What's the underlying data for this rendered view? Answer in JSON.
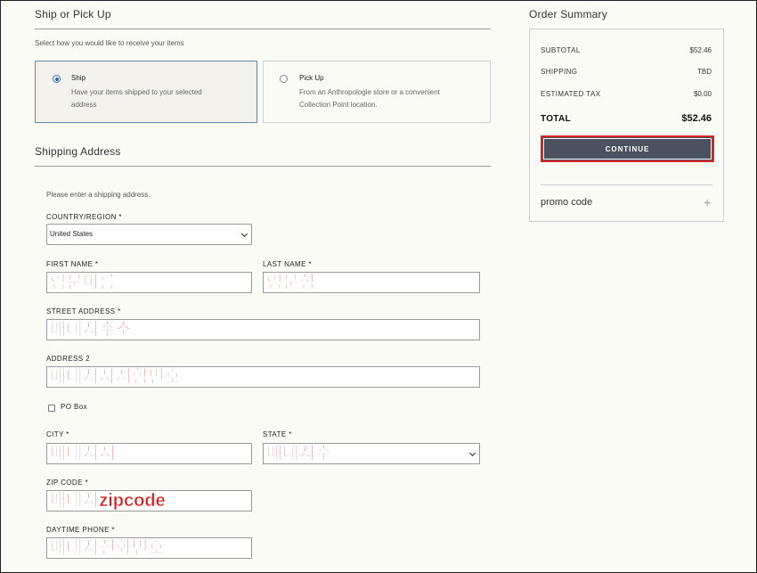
{
  "ship_section": {
    "title": "Ship or Pick Up",
    "subtitle": "Select how you would like to receive your items",
    "options": [
      {
        "title": "Ship",
        "desc_line1": "Have your items shipped to your selected",
        "desc_line2": "address"
      },
      {
        "title": "Pick Up",
        "desc_line1": "From an Anthropologie store or a convenient",
        "desc_line2": "Collection Point location."
      }
    ]
  },
  "address_section": {
    "title": "Shipping Address",
    "instruction": "Please enter a shipping address.",
    "country_label": "COUNTRY/REGION *",
    "country_value": "United States",
    "first_name_label": "FIRST NAME *",
    "first_name_value": "영문이름",
    "last_name_label": "LAST NAME *",
    "last_name_value": "영문성",
    "street_label": "STREET ADDRESS *",
    "street_value": "배대지주소",
    "address2_label": "ADDRESS 2",
    "address2_value": "배대지사서함번호",
    "po_box_label": "PO Box",
    "city_label": "CITY *",
    "city_value": "배대지시",
    "state_label": "STATE *",
    "state_value": "배대지주",
    "zip_label": "ZIP CODE *",
    "zip_value": "배대지zipcode",
    "phone_label": "DAYTIME PHONE *",
    "phone_value": "배대지전화번호"
  },
  "summary": {
    "title": "Order Summary",
    "subtotal_label": "SUBTOTAL",
    "subtotal_value": "$52.46",
    "shipping_label": "SHIPPING",
    "shipping_value": "TBD",
    "tax_label": "ESTIMATED TAX",
    "tax_value": "$0.00",
    "total_label": "TOTAL",
    "total_value": "$52.46",
    "continue_label": "CONTINUE",
    "promo_label": "promo code",
    "promo_icon": "+"
  },
  "colors": {
    "accent": "#4a5260",
    "highlight_red": "#e01414",
    "selected_border": "#6b86a3"
  }
}
